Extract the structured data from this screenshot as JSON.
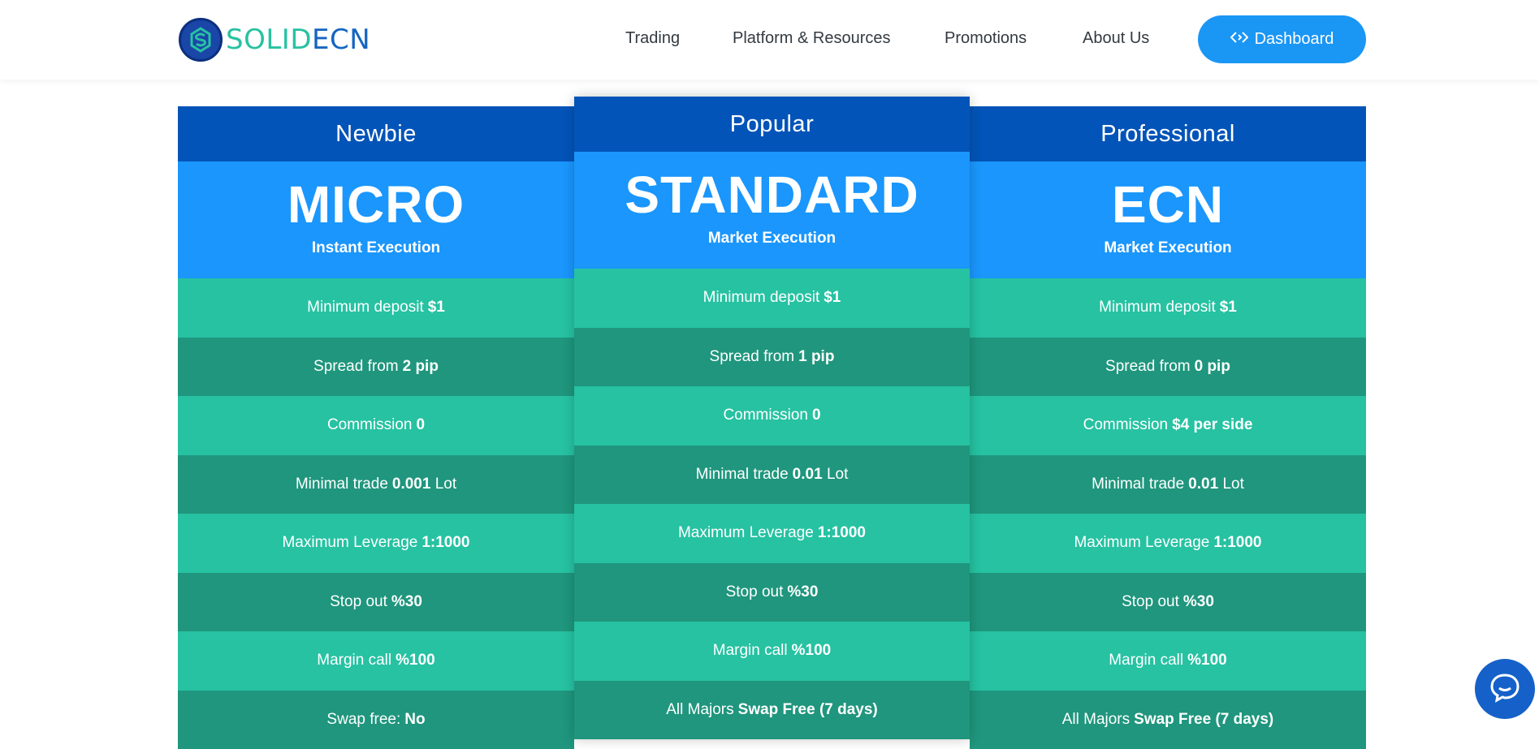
{
  "brand": {
    "part1": "SOLID",
    "part2": "ECN",
    "colors": {
      "teal": "#27c2a2",
      "blue": "#1565c0"
    }
  },
  "nav": {
    "items": [
      "Trading",
      "Platform & Resources",
      "Promotions",
      "About Us"
    ],
    "dashboard_label": "Dashboard"
  },
  "plans": [
    {
      "tier": "Newbie",
      "name": "MICRO",
      "execution": "Instant Execution",
      "rows": [
        {
          "label": "Minimum deposit",
          "value": "$1",
          "suffix": ""
        },
        {
          "label": "Spread from",
          "value": "2 pip",
          "suffix": ""
        },
        {
          "label": "Commission",
          "value": "0",
          "suffix": ""
        },
        {
          "label": "Minimal trade",
          "value": "0.001",
          "suffix": "Lot"
        },
        {
          "label": "Maximum Leverage",
          "value": "1:1000",
          "suffix": ""
        },
        {
          "label": "Stop out",
          "value": "%30",
          "suffix": ""
        },
        {
          "label": "Margin call",
          "value": "%100",
          "suffix": ""
        },
        {
          "label": "Swap free:",
          "value": "No",
          "suffix": ""
        }
      ]
    },
    {
      "tier": "Popular",
      "name": "STANDARD",
      "execution": "Market Execution",
      "rows": [
        {
          "label": "Minimum deposit",
          "value": "$1",
          "suffix": ""
        },
        {
          "label": "Spread from",
          "value": "1 pip",
          "suffix": ""
        },
        {
          "label": "Commission",
          "value": "0",
          "suffix": ""
        },
        {
          "label": "Minimal trade",
          "value": "0.01",
          "suffix": "Lot"
        },
        {
          "label": "Maximum Leverage",
          "value": "1:1000",
          "suffix": ""
        },
        {
          "label": "Stop out",
          "value": "%30",
          "suffix": ""
        },
        {
          "label": "Margin call",
          "value": "%100",
          "suffix": ""
        },
        {
          "label": "All Majors",
          "value": "Swap Free (7 days)",
          "suffix": ""
        }
      ]
    },
    {
      "tier": "Professional",
      "name": "ECN",
      "execution": "Market Execution",
      "rows": [
        {
          "label": "Minimum deposit",
          "value": "$1",
          "suffix": ""
        },
        {
          "label": "Spread from",
          "value": "0 pip",
          "suffix": ""
        },
        {
          "label": "Commission",
          "value": "$4 per side",
          "suffix": ""
        },
        {
          "label": "Minimal trade",
          "value": "0.01",
          "suffix": "Lot"
        },
        {
          "label": "Maximum Leverage",
          "value": "1:1000",
          "suffix": ""
        },
        {
          "label": "Stop out",
          "value": "%30",
          "suffix": ""
        },
        {
          "label": "Margin call",
          "value": "%100",
          "suffix": ""
        },
        {
          "label": "All Majors",
          "value": "Swap Free (7 days)",
          "suffix": ""
        }
      ]
    }
  ],
  "colors": {
    "tier_bg": "#0354b8",
    "plan_bg": "#1a96fc",
    "row_light": "#26c2a2",
    "row_dark": "#1f967d",
    "button": "#1a96f5"
  }
}
